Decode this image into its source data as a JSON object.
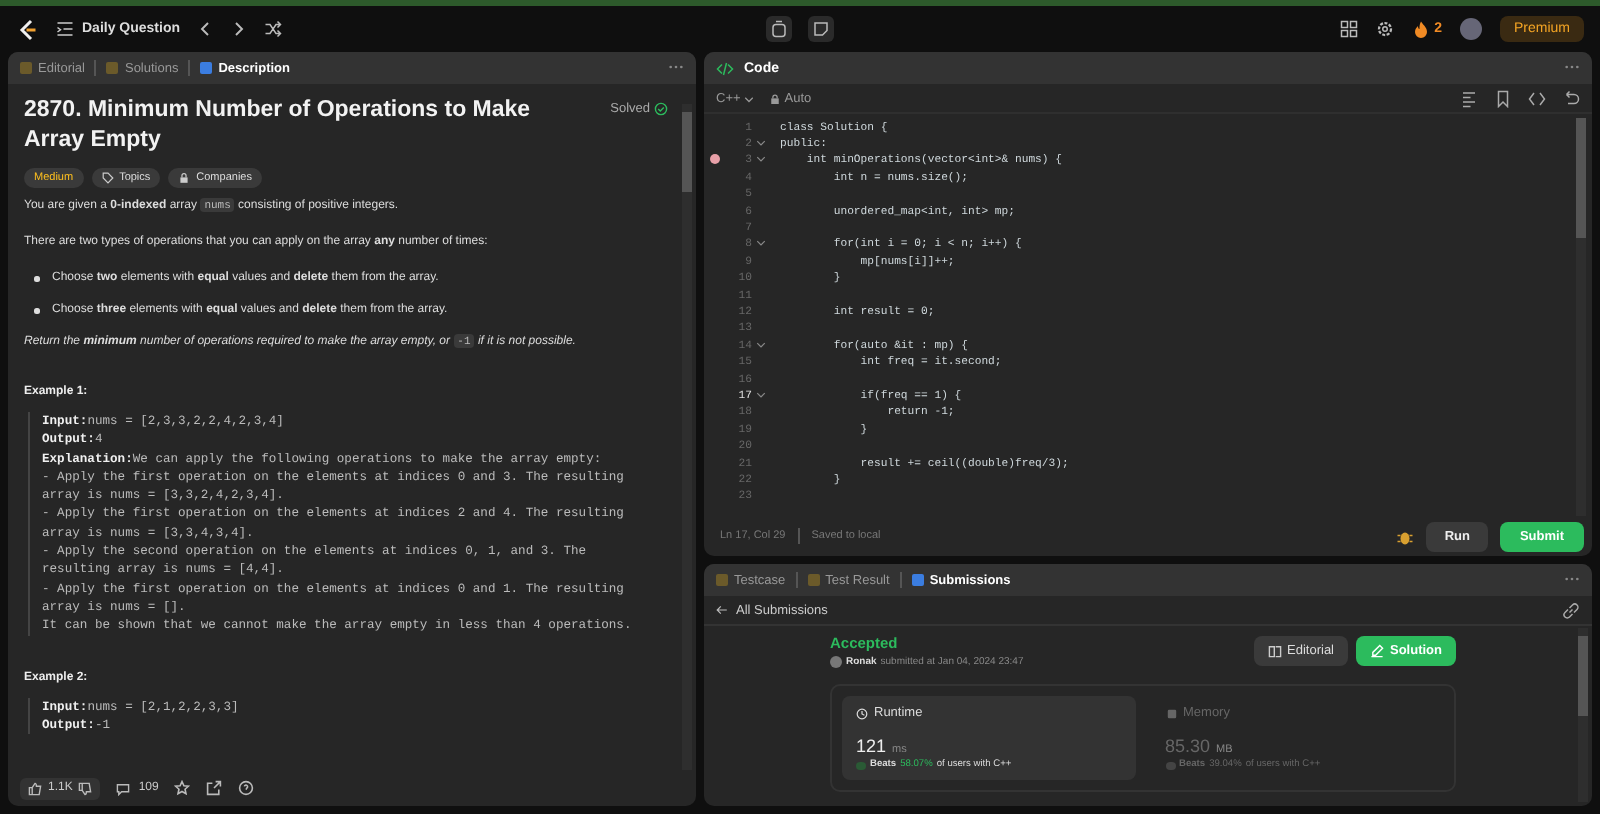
{
  "top_bar": {
    "problem_list": "Daily Question",
    "streak": "2",
    "premium": "Premium"
  },
  "description_panel": {
    "tabs": [
      {
        "label": "Editorial",
        "selected": false
      },
      {
        "label": "Solutions",
        "selected": false
      },
      {
        "label": "Description",
        "selected": true
      }
    ],
    "title": "2870. Minimum Number of Operations to Make Array Empty",
    "status": "Solved",
    "tags": [
      {
        "label": "Medium",
        "kind": "difficulty"
      },
      {
        "label": "Topics",
        "kind": "topics"
      },
      {
        "label": "Companies",
        "kind": "companies"
      }
    ],
    "paragraphs": [
      {
        "kind": "para",
        "italic": false,
        "parts": [
          {
            "kind": "text",
            "s": "You are given a **0-indexed** array "
          },
          {
            "kind": "code",
            "s": "nums"
          },
          {
            "kind": "text",
            "s": " consisting of positive integers."
          }
        ]
      },
      {
        "kind": "para",
        "italic": false,
        "parts": [
          {
            "kind": "text",
            "s": "There are two types of operations that you can apply on the array **any** number of times:"
          }
        ]
      },
      {
        "kind": "bullet",
        "italic": false,
        "parts": [
          {
            "kind": "text",
            "s": "Choose **two** elements with **equal** values and **delete** them from the array."
          }
        ]
      },
      {
        "kind": "bullet",
        "italic": false,
        "parts": [
          {
            "kind": "text",
            "s": "Choose **three** elements with **equal** values and **delete** them from the array."
          }
        ]
      },
      {
        "kind": "para",
        "italic": true,
        "parts": [
          {
            "kind": "text",
            "s": "Return the **minimum** number of operations required to make the array empty, or "
          },
          {
            "kind": "code",
            "s": "-1"
          },
          {
            "kind": "text",
            "s": " if it is not possible."
          }
        ]
      }
    ],
    "examples": [
      {
        "title": "Example 1:",
        "lines": [
          {
            "label": "Input:",
            "text": "nums = [2,3,3,2,2,4,2,3,4]"
          },
          {
            "label": "Output:",
            "text": "4"
          },
          {
            "label": "Explanation:",
            "text": "We can apply the following operations to make the array empty:"
          },
          {
            "text": "- Apply the first operation on the elements at indices 0 and 3. The resulting"
          },
          {
            "text": "array is nums = [3,3,2,4,2,3,4]."
          },
          {
            "text": "- Apply the first operation on the elements at indices 2 and 4. The resulting"
          },
          {
            "text": "array is nums = [3,3,4,3,4]."
          },
          {
            "text": "- Apply the second operation on the elements at indices 0, 1, and 3. The"
          },
          {
            "text": "resulting array is nums = [4,4]."
          },
          {
            "text": "- Apply the first operation on the elements at indices 0 and 1. The resulting"
          },
          {
            "text": "array is nums = []."
          },
          {
            "text": "It can be shown that we cannot make the array empty in less than 4 operations."
          }
        ]
      },
      {
        "title": "Example 2:",
        "lines": [
          {
            "label": "Input:",
            "text": "nums = [2,1,2,2,3,3]"
          },
          {
            "label": "Output:",
            "text": "-1"
          }
        ]
      }
    ],
    "footer": {
      "likes": "1.1K",
      "comments": "109"
    }
  },
  "code_panel": {
    "title": "Code",
    "language": "C++",
    "mode": "Auto",
    "lines": [
      {
        "num": "1",
        "code": "class Solution {",
        "fold": false,
        "breakpoint": false,
        "current": false
      },
      {
        "num": "2",
        "code": "public:",
        "fold": true,
        "breakpoint": false,
        "current": false
      },
      {
        "num": "3",
        "code": "    int minOperations(vector<int>& nums) {",
        "fold": true,
        "breakpoint": true,
        "current": false
      },
      {
        "num": "4",
        "code": "        int n = nums.size();",
        "fold": false,
        "breakpoint": false,
        "current": false
      },
      {
        "num": "5",
        "fold": false,
        "breakpoint": false,
        "current": false
      },
      {
        "num": "6",
        "code": "        unordered_map<int, int> mp;",
        "fold": false,
        "breakpoint": false,
        "current": false
      },
      {
        "num": "7",
        "fold": false,
        "breakpoint": false,
        "current": false
      },
      {
        "num": "8",
        "code": "        for(int i = 0; i < n; i++) {",
        "fold": true,
        "breakpoint": false,
        "current": false
      },
      {
        "num": "9",
        "code": "            mp[nums[i]]++;",
        "fold": false,
        "breakpoint": false,
        "current": false
      },
      {
        "num": "10",
        "code": "        }",
        "fold": false,
        "breakpoint": false,
        "current": false
      },
      {
        "num": "11",
        "fold": false,
        "breakpoint": false,
        "current": false
      },
      {
        "num": "12",
        "code": "        int result = 0;",
        "fold": false,
        "breakpoint": false,
        "current": false
      },
      {
        "num": "13",
        "fold": false,
        "breakpoint": false,
        "current": false
      },
      {
        "num": "14",
        "code": "        for(auto &it : mp) {",
        "fold": true,
        "breakpoint": false,
        "current": false
      },
      {
        "num": "15",
        "code": "            int freq = it.second;",
        "fold": false,
        "breakpoint": false,
        "current": false
      },
      {
        "num": "16",
        "fold": false,
        "breakpoint": false,
        "current": false
      },
      {
        "num": "17",
        "code": "            if(freq == 1) {",
        "fold": true,
        "breakpoint": false,
        "current": true
      },
      {
        "num": "18",
        "code": "                return -1;",
        "fold": false,
        "breakpoint": false,
        "current": false
      },
      {
        "num": "19",
        "code": "            }",
        "fold": false,
        "breakpoint": false,
        "current": false
      },
      {
        "num": "20",
        "fold": false,
        "breakpoint": false,
        "current": false
      },
      {
        "num": "21",
        "code": "            result += ceil((double)freq/3);",
        "fold": false,
        "breakpoint": false,
        "current": false
      },
      {
        "num": "22",
        "code": "        }",
        "fold": false,
        "breakpoint": false,
        "current": false
      },
      {
        "num": "23",
        "fold": false,
        "breakpoint": false,
        "current": false
      }
    ],
    "cursor": "Ln 17, Col 29",
    "save_status": "Saved to local",
    "run": "Run",
    "submit": "Submit"
  },
  "result_panel": {
    "tabs": [
      {
        "label": "Testcase",
        "selected": false
      },
      {
        "label": "Test Result",
        "selected": false
      },
      {
        "label": "Submissions",
        "selected": true
      }
    ],
    "back": "All Submissions",
    "verdict": "Accepted",
    "user": "Ronak",
    "submitted": "submitted at Jan 04, 2024 23:47",
    "editorial": "Editorial",
    "solution": "Solution",
    "stats": [
      {
        "label": "Runtime",
        "kind": "runtime",
        "selected": true,
        "value": "121",
        "unit": "ms",
        "beats": "Beats",
        "percent": "58.07%",
        "suffix": "of users with C++"
      },
      {
        "label": "Memory",
        "kind": "memory",
        "selected": false,
        "value": "85.30",
        "unit": "MB",
        "beats": "Beats",
        "percent": "39.04%",
        "suffix": "of users with C++"
      }
    ]
  }
}
